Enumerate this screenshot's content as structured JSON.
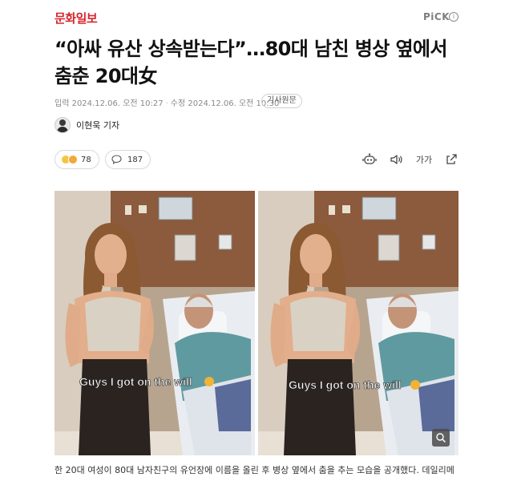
{
  "header": {
    "brand": "문화일보",
    "pick_label": "PiCK",
    "pick_info_icon": "info-circle-icon"
  },
  "article": {
    "headline_line1": "“아싸 유산 상속받는다”…80대 남친 병상 옆에서",
    "headline_line2": "춤춘 20대女",
    "published": "입력 2024.12.06. 오전 10:27",
    "modified": "수정 2024.12.06. 오전 10:30",
    "original_link": "기사원문",
    "reporter": "이현욱 기자",
    "reaction_count": "78",
    "comment_count": "187",
    "font_size_label": "가가",
    "photo_caption_text": "Guys I got on the will",
    "caption": "한 20대 여성이 80대 남자친구의 유언장에 이름을 올린 후 병상 옆에서 춤을 추는 모습을 공개했다. 데일리메"
  },
  "colors": {
    "brand": "#d6262d",
    "muted": "#888888",
    "border": "#d9d9d9"
  },
  "icons": [
    "info-circle-icon",
    "reaction-emoji-icon",
    "comment-bubble-icon",
    "robot-summary-icon",
    "speaker-icon",
    "share-icon",
    "zoom-icon"
  ]
}
